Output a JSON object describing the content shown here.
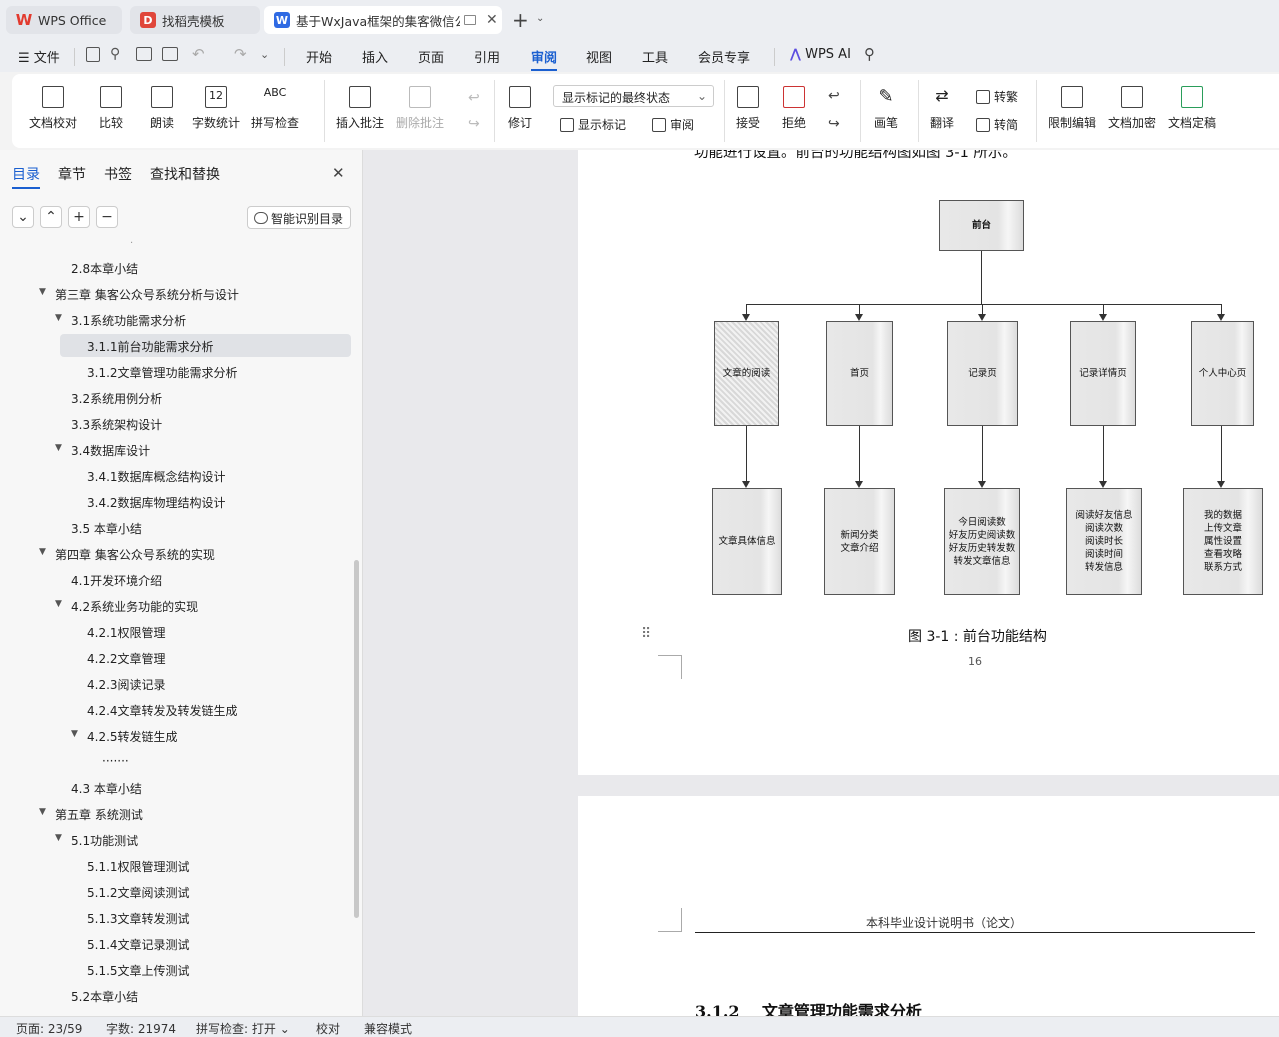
{
  "tabs": [
    {
      "label": "WPS Office",
      "icon": "wps-logo-icon"
    },
    {
      "label": "找稻壳模板",
      "icon": "docer-icon"
    },
    {
      "label": "基于WxJava框架的集客微信公",
      "icon": "writer-doc-icon"
    }
  ],
  "menu": {
    "file": "文件",
    "items": [
      "开始",
      "插入",
      "页面",
      "引用",
      "审阅",
      "视图",
      "工具",
      "会员专享"
    ],
    "active": "审阅",
    "ai": "WPS AI"
  },
  "ribbon": {
    "doc_proof": "文档校对",
    "compare": "比较",
    "read_aloud": "朗读",
    "word_count": "字数统计",
    "spell_check": "拼写检查",
    "spell_icon_text": "ABC",
    "word_count_icon_text": "12",
    "insert_comment": "插入批注",
    "delete_comment": "删除批注",
    "revise": "修订",
    "markup_state": "显示标记的最终状态",
    "show_markup": "显示标记",
    "review": "审阅",
    "accept": "接受",
    "reject": "拒绝",
    "pen": "画笔",
    "translate": "翻译",
    "to_traditional": "转繁",
    "to_simplified": "转简",
    "restrict_edit": "限制编辑",
    "encrypt": "文档加密",
    "finalize": "文档定稿"
  },
  "nav": {
    "tabs": [
      "目录",
      "章节",
      "书签",
      "查找和替换"
    ],
    "smart_toc": "智能识别目录",
    "items": [
      {
        "text": "2.8本章小结",
        "level": 2
      },
      {
        "text": "第三章 集客公众号系统分析与设计",
        "level": 1
      },
      {
        "text": "3.1系统功能需求分析",
        "level": 2
      },
      {
        "text": "3.1.1前台功能需求分析",
        "level": 3,
        "selected": true
      },
      {
        "text": "3.1.2文章管理功能需求分析",
        "level": 3
      },
      {
        "text": "3.2系统用例分析",
        "level": 2
      },
      {
        "text": "3.3系统架构设计",
        "level": 2
      },
      {
        "text": "3.4数据库设计",
        "level": 2
      },
      {
        "text": "3.4.1数据库概念结构设计",
        "level": 3
      },
      {
        "text": "3.4.2数据库物理结构设计",
        "level": 3
      },
      {
        "text": "3.5 本章小结",
        "level": 2
      },
      {
        "text": "第四章 集客公众号系统的实现",
        "level": 1
      },
      {
        "text": "4.1开发环境介绍",
        "level": 2
      },
      {
        "text": "4.2系统业务功能的实现",
        "level": 2
      },
      {
        "text": "4.2.1权限管理",
        "level": 3
      },
      {
        "text": "4.2.2文章管理",
        "level": 3
      },
      {
        "text": "4.2.3阅读记录",
        "level": 3
      },
      {
        "text": "4.2.4文章转发及转发链生成",
        "level": 3
      },
      {
        "text": "4.2.5转发链生成",
        "level": 3
      },
      {
        "text": "·······",
        "level": 4
      },
      {
        "text": "4.3 本章小结",
        "level": 2
      },
      {
        "text": "第五章 系统测试",
        "level": 1
      },
      {
        "text": "5.1功能测试",
        "level": 2
      },
      {
        "text": "5.1.1权限管理测试",
        "level": 3
      },
      {
        "text": "5.1.2文章阅读测试",
        "level": 3
      },
      {
        "text": "5.1.3文章转发测试",
        "level": 3
      },
      {
        "text": "5.1.4文章记录测试",
        "level": 3
      },
      {
        "text": "5.1.5文章上传测试",
        "level": 3
      },
      {
        "text": "5.2本章小结",
        "level": 2
      }
    ]
  },
  "doc": {
    "partial_line": "功能进行设置。前台的功能结构图如图 3-1 所示。",
    "diagram": {
      "root": "前台",
      "level1": [
        "文章的阅读",
        "首页",
        "记录页",
        "记录详情页",
        "个人中心页"
      ],
      "level2": [
        [
          "文章具体信息"
        ],
        [
          "新闻分类",
          "文章介绍"
        ],
        [
          "今日阅读数",
          "好友历史阅读数",
          "好友历史转发数",
          "转发文章信息"
        ],
        [
          "阅读好友信息",
          "阅读次数",
          "阅读时长",
          "阅读时间",
          "转发信息"
        ],
        [
          "我的数据",
          "上传文章",
          "属性设置",
          "查看攻略",
          "联系方式"
        ]
      ]
    },
    "caption": "图 3-1 : 前台功能结构",
    "page_number": "16",
    "next_header": "本科毕业设计说明书（论文）",
    "next_heading": "3.1.2    文章管理功能需求分析"
  },
  "status": {
    "page": "页面: 23/59",
    "words": "字数: 21974",
    "spell": "拼写检查: 打开",
    "proof": "校对",
    "compat": "兼容模式"
  }
}
